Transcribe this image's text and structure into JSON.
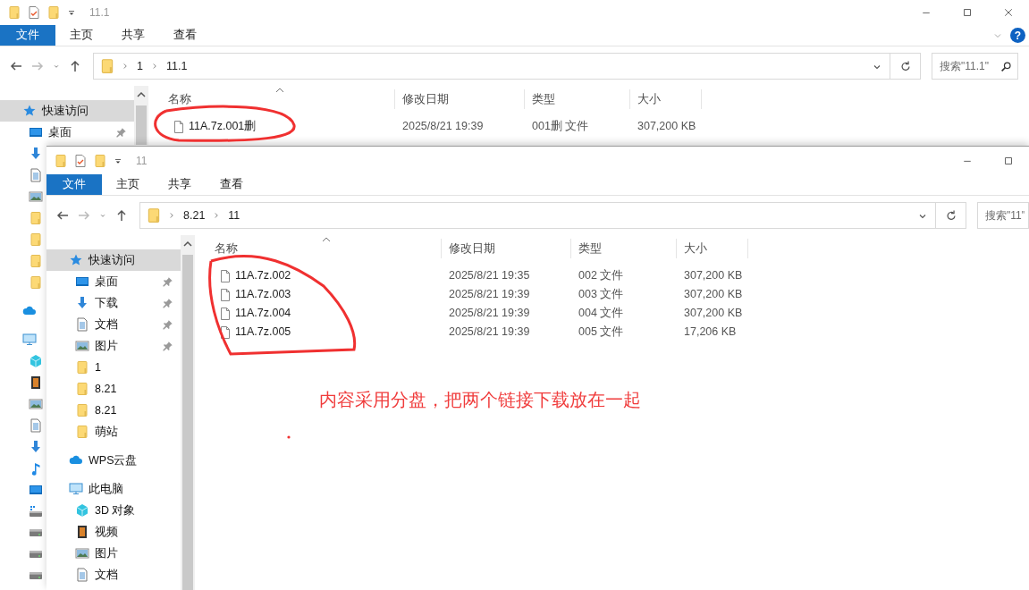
{
  "windows": [
    {
      "title": "11.1",
      "controls": [
        {
          "kind": "minimize"
        },
        {
          "kind": "maximize"
        },
        {
          "kind": "close"
        }
      ],
      "help": "?",
      "ribbon_tabs": [
        {
          "label": "文件",
          "selected": true
        },
        {
          "label": "主页",
          "selected": false
        },
        {
          "label": "共享",
          "selected": false
        },
        {
          "label": "查看",
          "selected": false
        }
      ],
      "path": [
        "1",
        "11.1"
      ],
      "search": {
        "placeholder": "搜索\"11.1\"",
        "icon": true
      },
      "sidebar": [
        {
          "label": "快速访问",
          "kind": "quick",
          "selected": true,
          "children": [
            {
              "label": "桌面",
              "kind": "desktop",
              "selected": false,
              "pinned": true
            },
            {
              "kind": "download",
              "selected": false
            },
            {
              "kind": "document",
              "selected": false
            },
            {
              "kind": "picture",
              "selected": false
            },
            {
              "kind": "folder",
              "selected": false
            },
            {
              "kind": "folder",
              "selected": false
            },
            {
              "kind": "folder",
              "selected": false
            },
            {
              "kind": "folder",
              "selected": false
            }
          ]
        },
        {
          "kind": "cloud",
          "selected": false
        },
        {
          "kind": "pc",
          "selected": false,
          "children": [
            {
              "kind": "cube",
              "selected": false
            },
            {
              "kind": "video",
              "selected": false
            },
            {
              "kind": "picture",
              "selected": false
            },
            {
              "kind": "document",
              "selected": false
            },
            {
              "kind": "download",
              "selected": false
            },
            {
              "kind": "music",
              "selected": false
            },
            {
              "kind": "desktop",
              "selected": false
            },
            {
              "kind": "netdrive",
              "selected": false
            },
            {
              "kind": "drive",
              "selected": false
            },
            {
              "kind": "drive",
              "selected": false
            },
            {
              "kind": "drive",
              "selected": false
            }
          ]
        }
      ],
      "columns": [
        {
          "label": "名称",
          "sorted": true
        },
        {
          "label": "修改日期",
          "sorted": false
        },
        {
          "label": "类型",
          "sorted": false
        },
        {
          "label": "大小",
          "sorted": false
        }
      ],
      "files": [
        {
          "name": "11A.7z.001删",
          "date": "2025/8/21 19:39",
          "type": "001删 文件",
          "size": "307,200 KB"
        }
      ]
    },
    {
      "title": "11",
      "controls": [
        {
          "kind": "minimize"
        },
        {
          "kind": "maximize"
        }
      ],
      "ribbon_tabs": [
        {
          "label": "文件",
          "selected": true
        },
        {
          "label": "主页",
          "selected": false
        },
        {
          "label": "共享",
          "selected": false
        },
        {
          "label": "查看",
          "selected": false
        }
      ],
      "path": [
        "8.21",
        "11"
      ],
      "search": {
        "placeholder": "搜索\"11\""
      },
      "sidebar": [
        {
          "label": "快速访问",
          "kind": "quick",
          "selected": true,
          "children": [
            {
              "label": "桌面",
              "kind": "desktop",
              "selected": false,
              "pinned": true
            },
            {
              "label": "下载",
              "kind": "download",
              "selected": false,
              "pinned": true
            },
            {
              "label": "文档",
              "kind": "document",
              "selected": false,
              "pinned": true
            },
            {
              "label": "图片",
              "kind": "picture",
              "selected": false,
              "pinned": true
            },
            {
              "label": "1",
              "kind": "folder",
              "selected": false,
              "pinned": false
            },
            {
              "label": "8.21",
              "kind": "folder",
              "selected": false,
              "pinned": false
            },
            {
              "label": "8.21",
              "kind": "folder",
              "selected": false,
              "pinned": false
            },
            {
              "label": "萌站",
              "kind": "folder",
              "selected": false,
              "pinned": false
            }
          ]
        },
        {
          "label": "WPS云盘",
          "kind": "cloud",
          "selected": false
        },
        {
          "label": "此电脑",
          "kind": "pc",
          "selected": false,
          "children": [
            {
              "label": "3D 对象",
              "kind": "cube",
              "selected": false,
              "pinned": false
            },
            {
              "label": "视频",
              "kind": "video",
              "selected": false,
              "pinned": false
            },
            {
              "label": "图片",
              "kind": "picture",
              "selected": false,
              "pinned": false
            },
            {
              "label": "文档",
              "kind": "document",
              "selected": false,
              "pinned": false
            }
          ]
        }
      ],
      "columns": [
        {
          "label": "名称",
          "sorted": true
        },
        {
          "label": "修改日期",
          "sorted": false
        },
        {
          "label": "类型",
          "sorted": false
        },
        {
          "label": "大小",
          "sorted": false
        }
      ],
      "files": [
        {
          "name": "11A.7z.002",
          "date": "2025/8/21 19:35",
          "type": "002 文件",
          "size": "307,200 KB"
        },
        {
          "name": "11A.7z.003",
          "date": "2025/8/21 19:39",
          "type": "003 文件",
          "size": "307,200 KB"
        },
        {
          "name": "11A.7z.004",
          "date": "2025/8/21 19:39",
          "type": "004 文件",
          "size": "307,200 KB"
        },
        {
          "name": "11A.7z.005",
          "date": "2025/8/21 19:39",
          "type": "005 文件",
          "size": "17,206 KB"
        }
      ]
    }
  ],
  "annotation": {
    "text": "内容采用分盘，把两个链接下载放在一起"
  }
}
